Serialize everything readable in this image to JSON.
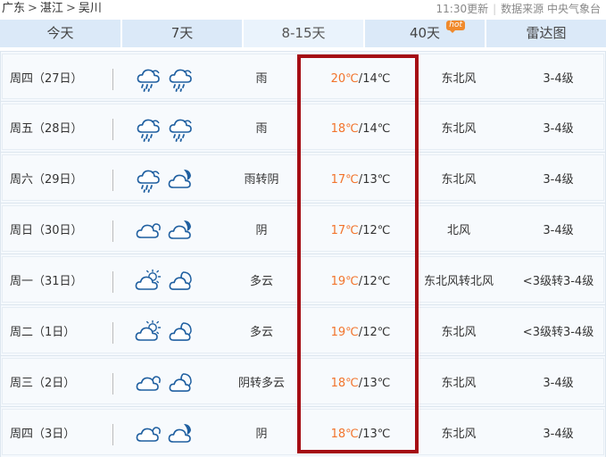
{
  "breadcrumb": {
    "province": "广东",
    "city": "湛江",
    "district": "吴川",
    "separator": ">"
  },
  "meta": {
    "update_time": "11:30更新",
    "source_label": "数据来源",
    "source": "中央气象台"
  },
  "tabs": [
    {
      "label": "今天",
      "active": false
    },
    {
      "label": "7天",
      "active": false
    },
    {
      "label": "8-15天",
      "active": true
    },
    {
      "label": "40天",
      "active": false,
      "badge": "hot"
    },
    {
      "label": "雷达图",
      "active": false
    }
  ],
  "forecast": [
    {
      "day": "周四（27日）",
      "icons": [
        "rain-cloud-icon",
        "rain-cloud-icon"
      ],
      "weather": "雨",
      "high": "20℃",
      "low": "14℃",
      "wind": "东北风",
      "level": "3-4级"
    },
    {
      "day": "周五（28日）",
      "icons": [
        "rain-cloud-icon",
        "rain-cloud-icon"
      ],
      "weather": "雨",
      "high": "18℃",
      "low": "14℃",
      "wind": "东北风",
      "level": "3-4级"
    },
    {
      "day": "周六（29日）",
      "icons": [
        "rain-cloud-icon",
        "cloud-moon-icon"
      ],
      "weather": "雨转阴",
      "high": "17℃",
      "low": "13℃",
      "wind": "东北风",
      "level": "3-4级"
    },
    {
      "day": "周日（30日）",
      "icons": [
        "cloud-icon",
        "cloud-moon-icon"
      ],
      "weather": "阴",
      "high": "17℃",
      "low": "12℃",
      "wind": "北风",
      "level": "3-4级"
    },
    {
      "day": "周一（31日）",
      "icons": [
        "sun-cloud-icon",
        "moon-cloud-icon"
      ],
      "weather": "多云",
      "high": "19℃",
      "low": "12℃",
      "wind": "东北风转北风",
      "level": "<3级转3-4级"
    },
    {
      "day": "周二（1日）",
      "icons": [
        "sun-cloud-icon",
        "moon-cloud-icon"
      ],
      "weather": "多云",
      "high": "19℃",
      "low": "12℃",
      "wind": "东北风",
      "level": "<3级转3-4级"
    },
    {
      "day": "周三（2日）",
      "icons": [
        "cloud-icon",
        "moon-cloud-icon"
      ],
      "weather": "阴转多云",
      "high": "18℃",
      "low": "13℃",
      "wind": "东北风",
      "level": "3-4级"
    },
    {
      "day": "周四（3日）",
      "icons": [
        "cloud-icon",
        "cloud-moon-icon"
      ],
      "weather": "阴",
      "high": "18℃",
      "low": "13℃",
      "wind": "东北风",
      "level": "3-4级"
    }
  ],
  "colors": {
    "tab_bg": "#dbe9f8",
    "tab_active_bg": "#eaf3fc",
    "high_temp": "#f2742c",
    "highlight_border": "#a50d14",
    "icon_stroke": "#1f5fa0",
    "badge": "#f08a2c"
  }
}
